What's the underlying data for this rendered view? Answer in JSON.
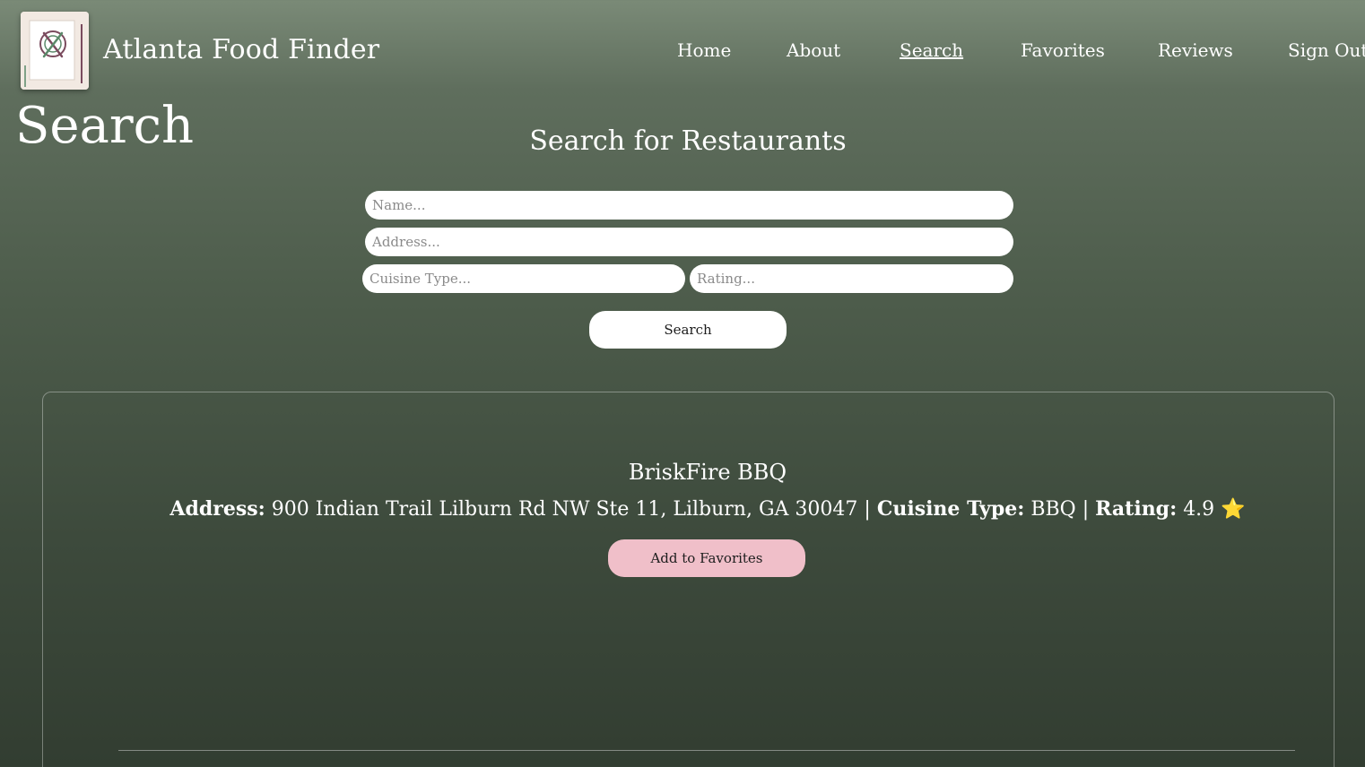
{
  "header": {
    "brand": "Atlanta Food Finder",
    "logo_icon": "atlanta-food-finder-logo"
  },
  "nav": {
    "home": "Home",
    "about": "About",
    "search": "Search",
    "favorites": "Favorites",
    "reviews": "Reviews",
    "sign_out": "Sign Out",
    "active": "Search"
  },
  "page": {
    "title": "Search"
  },
  "search_form": {
    "heading": "Search for Restaurants",
    "name_placeholder": "Name...",
    "address_placeholder": "Address...",
    "cuisine_placeholder": "Cuisine Type...",
    "rating_placeholder": "Rating...",
    "submit_label": "Search"
  },
  "results": [
    {
      "name": "BriskFire BBQ",
      "address_label": "Address:",
      "address": "900 Indian Trail Lilburn Rd NW Ste 11, Lilburn, GA 30047",
      "separator": "|",
      "cuisine_label": "Cuisine Type:",
      "cuisine": "BBQ",
      "rating_label": "Rating:",
      "rating": "4.9",
      "star": "⭐",
      "favorite_button": "Add to Favorites"
    }
  ],
  "colors": {
    "background_top": "#7a8a77",
    "background_bottom": "#323d31",
    "favorite_button": "#f0bfc9",
    "star": "#f7c948"
  }
}
